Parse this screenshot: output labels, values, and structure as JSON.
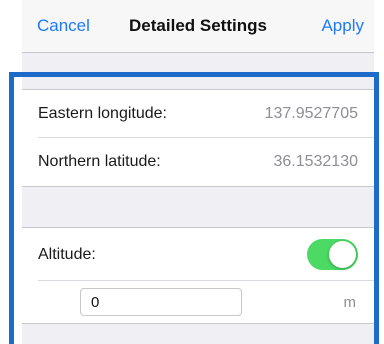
{
  "navbar": {
    "cancel_label": "Cancel",
    "title": "Detailed Settings",
    "apply_label": "Apply"
  },
  "location": {
    "longitude_label": "Eastern longitude:",
    "longitude_value": "137.9527705",
    "latitude_label": "Northern latitude:",
    "latitude_value": "36.1532130"
  },
  "altitude": {
    "label": "Altitude:",
    "enabled": true,
    "value": "0",
    "unit": "m"
  },
  "colors": {
    "accent": "#1f7bf5",
    "toggle_on": "#4cd964",
    "highlight": "#1e6cc9",
    "group_background": "#efeff4"
  }
}
